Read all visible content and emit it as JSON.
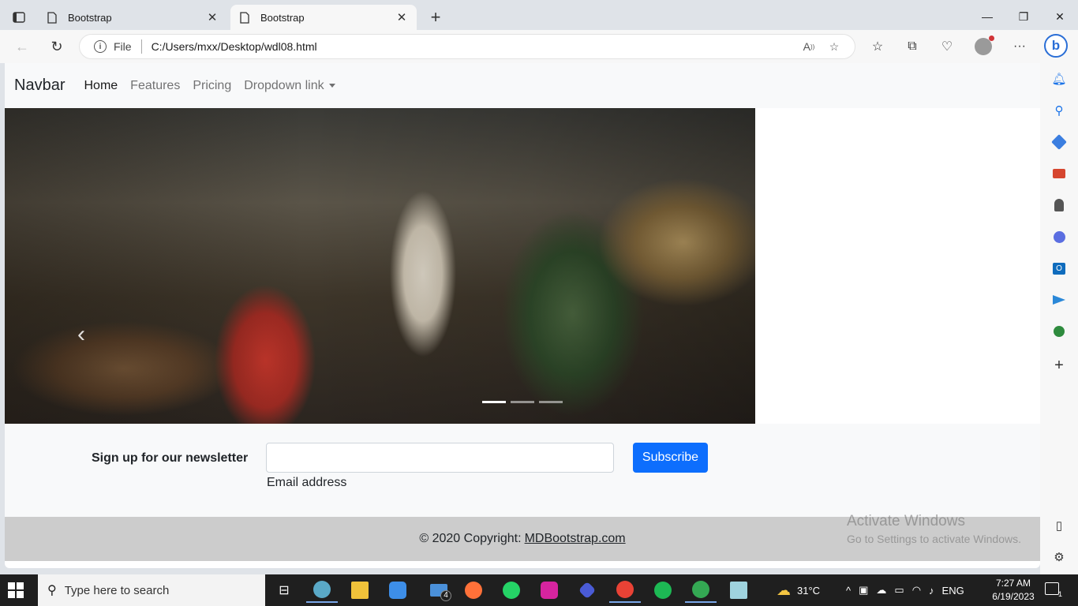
{
  "browser": {
    "tabs": [
      {
        "title": "Bootstrap",
        "active": false
      },
      {
        "title": "Bootstrap",
        "active": true
      }
    ],
    "address": {
      "scheme_label": "File",
      "url": "C:/Users/mxx/Desktop/wdl08.html"
    }
  },
  "page": {
    "navbar": {
      "brand": "Navbar",
      "links": [
        "Home",
        "Features",
        "Pricing",
        "Dropdown link"
      ]
    },
    "carousel": {
      "slides": 3,
      "active_slide": 1,
      "prev_glyph": "‹"
    },
    "newsletter": {
      "label": "Sign up for our newsletter",
      "input_value": "",
      "input_label": "Email address",
      "button": "Subscribe"
    },
    "footer": {
      "copyright": "© 2020 Copyright:",
      "link": "MDBootstrap.com"
    },
    "watermark": {
      "line1": "Activate Windows",
      "line2": "Go to Settings to activate Windows."
    }
  },
  "taskbar": {
    "search_placeholder": "Type here to search",
    "mail_badge": "4",
    "weather": "31°C",
    "language": "ENG",
    "time": "7:27 AM",
    "date": "6/19/2023",
    "notification_count": "1"
  },
  "colors": {
    "primary": "#0d6efd",
    "navbar_bg": "#f8f9fa",
    "taskbar": "#1f1f1f"
  }
}
